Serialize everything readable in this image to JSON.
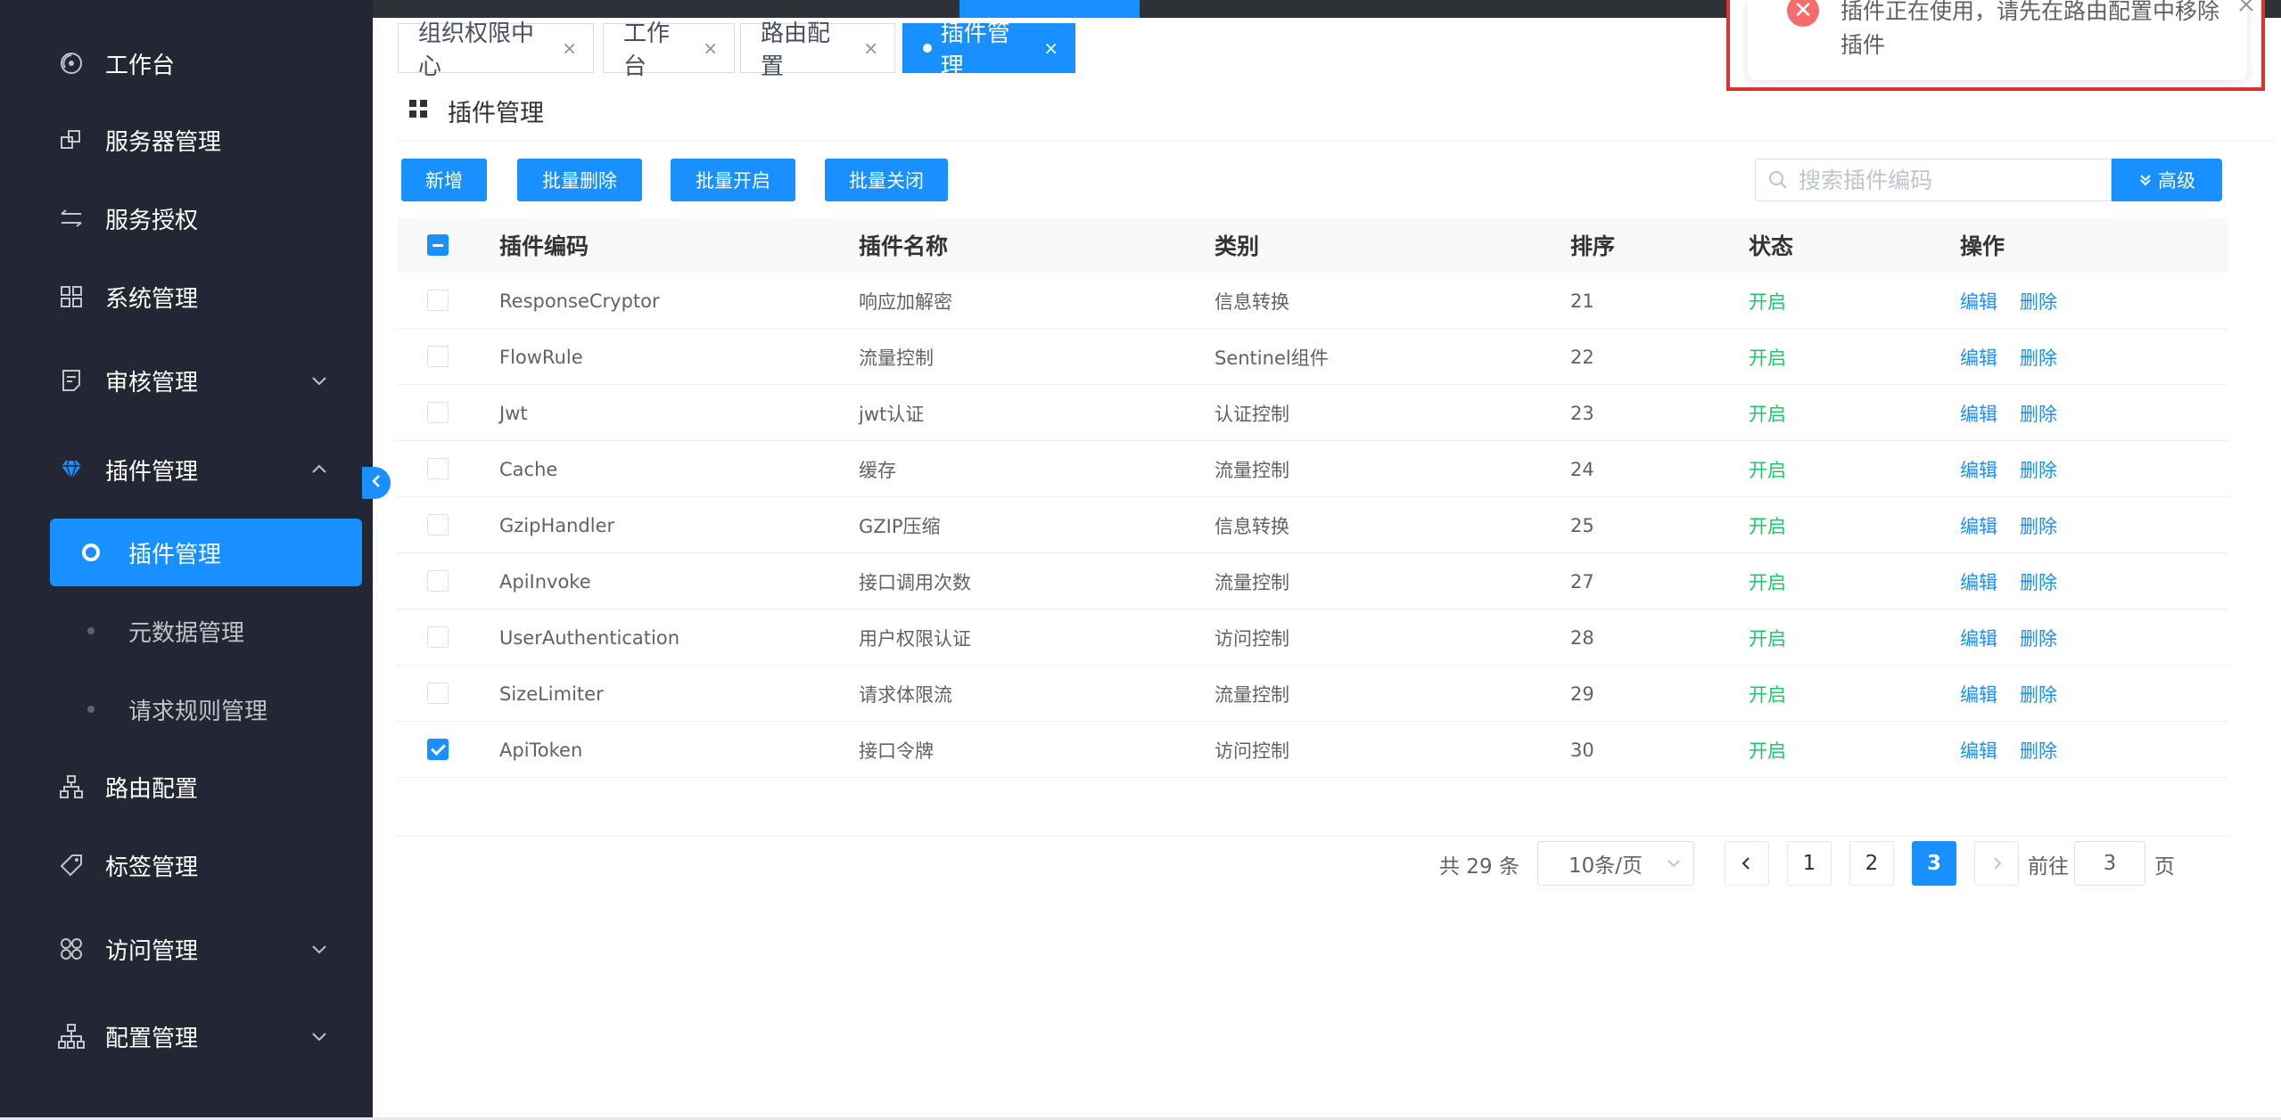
{
  "sidebar": {
    "items": [
      {
        "label": "工作台",
        "icon": "dashboard-icon"
      },
      {
        "label": "服务器管理",
        "icon": "server-icon"
      },
      {
        "label": "服务授权",
        "icon": "swap-icon"
      },
      {
        "label": "系统管理",
        "icon": "grid-icon"
      },
      {
        "label": "审核管理",
        "icon": "audit-icon"
      },
      {
        "label": "插件管理",
        "icon": "diamond-icon"
      },
      {
        "label": "路由配置",
        "icon": "tree-icon"
      },
      {
        "label": "标签管理",
        "icon": "tag-icon"
      },
      {
        "label": "访问管理",
        "icon": "apps-icon"
      },
      {
        "label": "配置管理",
        "icon": "org-icon"
      }
    ],
    "sub": {
      "active": "插件管理",
      "items": [
        "元数据管理",
        "请求规则管理"
      ]
    }
  },
  "tabs": [
    {
      "label": "组织权限中心",
      "close": "×"
    },
    {
      "label": "工作台",
      "close": "×"
    },
    {
      "label": "路由配置",
      "close": "×"
    },
    {
      "label": "插件管理",
      "close": "×"
    }
  ],
  "page": {
    "title": "插件管理"
  },
  "toolbar": {
    "add": "新增",
    "batch_delete": "批量删除",
    "batch_enable": "批量开启",
    "batch_disable": "批量关闭",
    "search_placeholder": "搜索插件编码",
    "advanced": "高级"
  },
  "table": {
    "headers": {
      "code": "插件编码",
      "name": "插件名称",
      "category": "类别",
      "sort": "排序",
      "status": "状态",
      "ops": "操作"
    },
    "edit": "编辑",
    "delete": "删除",
    "rows": [
      {
        "code": "ResponseCryptor",
        "name": "响应加解密",
        "category": "信息转换",
        "sort": "21",
        "status": "开启",
        "checked": false
      },
      {
        "code": "FlowRule",
        "name": "流量控制",
        "category": "Sentinel组件",
        "sort": "22",
        "status": "开启",
        "checked": false
      },
      {
        "code": "Jwt",
        "name": "jwt认证",
        "category": "认证控制",
        "sort": "23",
        "status": "开启",
        "checked": false
      },
      {
        "code": "Cache",
        "name": "缓存",
        "category": "流量控制",
        "sort": "24",
        "status": "开启",
        "checked": false
      },
      {
        "code": "GzipHandler",
        "name": "GZIP压缩",
        "category": "信息转换",
        "sort": "25",
        "status": "开启",
        "checked": false
      },
      {
        "code": "ApiInvoke",
        "name": "接口调用次数",
        "category": "流量控制",
        "sort": "27",
        "status": "开启",
        "checked": false
      },
      {
        "code": "UserAuthentication",
        "name": "用户权限认证",
        "category": "访问控制",
        "sort": "28",
        "status": "开启",
        "checked": false
      },
      {
        "code": "SizeLimiter",
        "name": "请求体限流",
        "category": "流量控制",
        "sort": "29",
        "status": "开启",
        "checked": false
      },
      {
        "code": "ApiToken",
        "name": "接口令牌",
        "category": "访问控制",
        "sort": "30",
        "status": "开启",
        "checked": true
      }
    ]
  },
  "pagination": {
    "total": "共 29 条",
    "page_size": "10条/页",
    "pages": [
      "1",
      "2",
      "3"
    ],
    "current": "3",
    "goto_label": "前往",
    "goto_value": "3",
    "page_suffix": "页"
  },
  "notification": {
    "message": "插件正在使用，请先在路由配置中移除插件",
    "icon": "error-icon"
  },
  "colors": {
    "primary": "#1890ff",
    "sidebar": "#222733",
    "success": "#13ce66",
    "error": "#f56c6c"
  }
}
